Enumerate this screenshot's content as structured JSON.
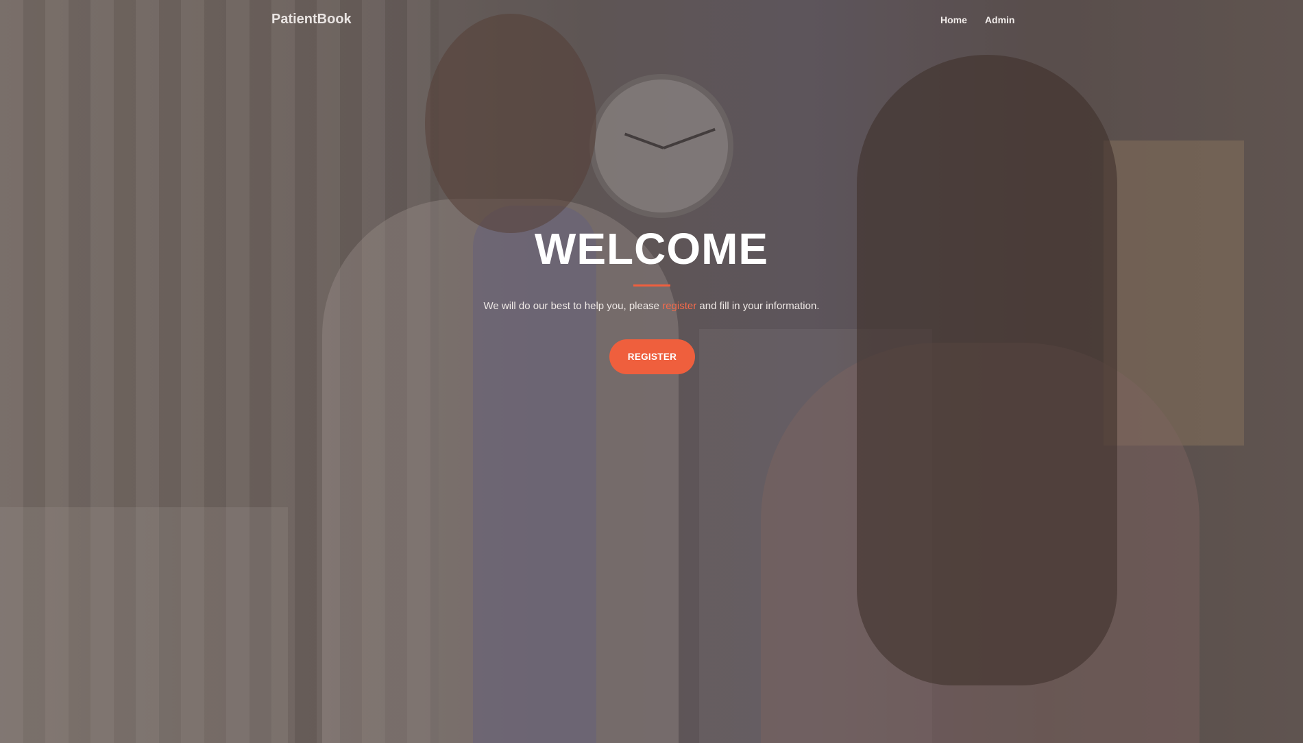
{
  "navbar": {
    "brand": "PatientBook",
    "links": [
      "Home",
      "Admin"
    ]
  },
  "hero": {
    "title": "WELCOME",
    "subtitle_before": "We will do our best to help you, please ",
    "subtitle_link": "register",
    "subtitle_after": " and fill in your information.",
    "button_label": "REGISTER"
  },
  "colors": {
    "accent": "#ef5f3d",
    "overlay": "rgba(60,45,40,0.28)"
  }
}
